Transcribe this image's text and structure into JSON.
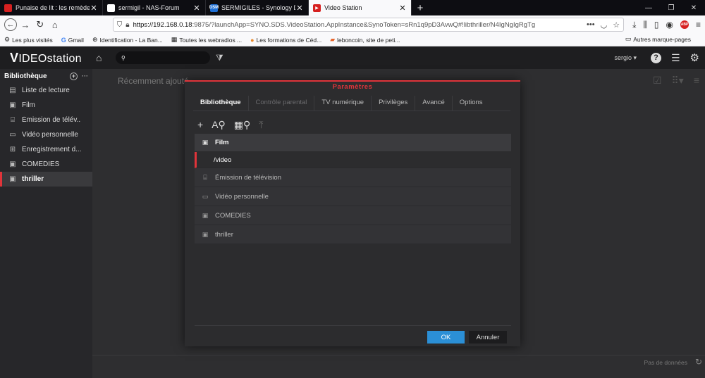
{
  "browser": {
    "tabs": [
      {
        "label": "Punaise de lit : les remèdes de",
        "fav_color": "#d62020"
      },
      {
        "label": "sermigil - NAS-Forum",
        "fav_color": "#ffffff"
      },
      {
        "label": "SERMIGILES - Synology DiskSta",
        "fav_color": "#1d6fd6"
      },
      {
        "label": "Video Station",
        "fav_color": "#d62020"
      }
    ],
    "url_host": "https://192.168.0.18",
    "url_rest": ":9875/?launchApp=SYNO.SDS.VideoStation.AppInstance&SynoToken=sRn1q9pD3AvwQ#!libthriller/N4IgNgIgRgTg",
    "bookmarks": [
      {
        "label": "Les plus visités",
        "icon": "⚙"
      },
      {
        "label": "Gmail",
        "icon": "G"
      },
      {
        "label": "Identification - La Ban...",
        "icon": "⊕"
      },
      {
        "label": "Toutes les webradios ...",
        "icon": "▦"
      },
      {
        "label": "Les formations de Céd...",
        "icon": "●"
      },
      {
        "label": "leboncoin, site de peti...",
        "icon": "▰"
      }
    ],
    "bookmarks_other": "Autres marque-pages"
  },
  "app": {
    "logo_v": "V",
    "logo_rest": "IDEOstation",
    "user": "sergio ▾"
  },
  "sidebar": {
    "title": "Bibliothèque",
    "items": [
      {
        "label": "Liste de lecture",
        "icon": "▤"
      },
      {
        "label": "Film",
        "icon": "▣"
      },
      {
        "label": "Émission de télév...",
        "icon": "⌸"
      },
      {
        "label": "Vidéo personnelle",
        "icon": "▭"
      },
      {
        "label": "Enregistrement d...",
        "icon": "⊞"
      },
      {
        "label": "COMEDIES",
        "icon": "▣"
      },
      {
        "label": "thriller",
        "icon": "▣"
      }
    ]
  },
  "main": {
    "title": "Récemment ajouté",
    "no_data": "Pas de données"
  },
  "modal": {
    "title": "Paramètres",
    "tabs": [
      "Bibliothèque",
      "Contrôle parental",
      "TV numérique",
      "Privilèges",
      "Avancé",
      "Options"
    ],
    "list": {
      "header": "Film",
      "path": "/video",
      "rows": [
        "Émission de télévision",
        "Vidéo personnelle",
        "COMEDIES",
        "thriller"
      ]
    },
    "ok_label": "OK",
    "cancel_label": "Annuler"
  }
}
